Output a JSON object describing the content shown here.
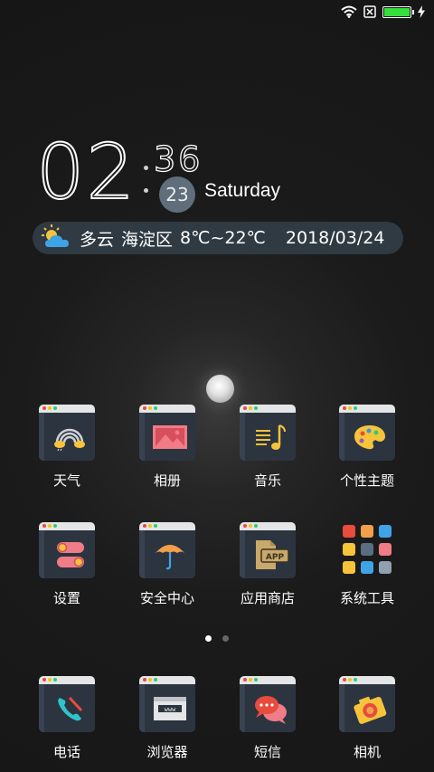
{
  "status_bar": {
    "wifi_icon": "wifi-icon",
    "sim_icon": "no-sim-icon",
    "battery_level": 1.0,
    "battery_color": "#35e03a",
    "charging_icon": "lightning-icon"
  },
  "clock": {
    "hour": "02",
    "minute": "36",
    "day": "23",
    "weekday": "Saturday"
  },
  "weather": {
    "icon": "partly-cloudy-icon",
    "condition": "多云",
    "district": "海淀区",
    "temperature": "8℃~22℃",
    "date": "2018/03/24"
  },
  "apps_row1": [
    {
      "label": "天气",
      "icon": "rainbow-icon"
    },
    {
      "label": "相册",
      "icon": "photo-icon"
    },
    {
      "label": "音乐",
      "icon": "music-note-icon"
    },
    {
      "label": "个性主题",
      "icon": "palette-icon"
    }
  ],
  "apps_row2": [
    {
      "label": "设置",
      "icon": "toggle-switch-icon"
    },
    {
      "label": "安全中心",
      "icon": "umbrella-icon"
    },
    {
      "label": "应用商店",
      "icon": "app-file-icon"
    },
    {
      "label": "系统工具",
      "icon": "folder-grid-icon"
    }
  ],
  "dock": [
    {
      "label": "电话",
      "icon": "phone-icon"
    },
    {
      "label": "浏览器",
      "icon": "browser-www-icon"
    },
    {
      "label": "短信",
      "icon": "chat-bubbles-icon"
    },
    {
      "label": "相机",
      "icon": "camera-icon"
    }
  ],
  "page_indicator": {
    "pages": 2,
    "current": 1
  },
  "colors": {
    "icon_body": "#2c3440",
    "weather_bar": "#2f3a43",
    "day_circle": "#5f6e7a"
  }
}
